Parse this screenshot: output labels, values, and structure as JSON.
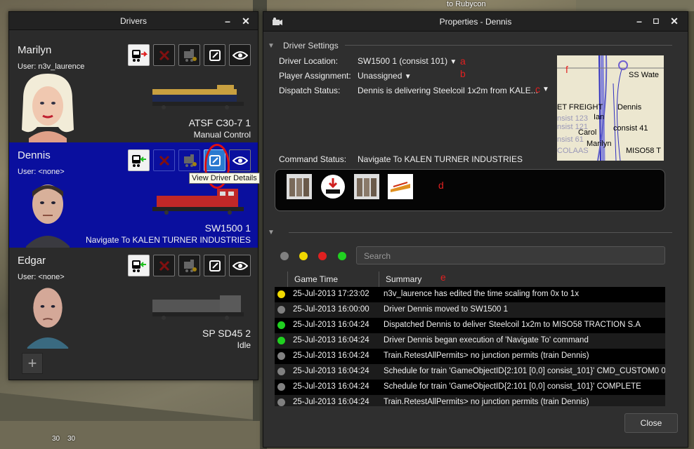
{
  "background": {
    "top_text": "to Rubycon",
    "sign_1": "30",
    "sign_2": "30"
  },
  "drivers_window": {
    "title": "Drivers",
    "minimize_label": "–",
    "close_label": "✕",
    "drivers": [
      {
        "name": "Marilyn",
        "user": "User: n3v_laurence",
        "loco_name": "ATSF C30-7 1",
        "status": "Manual Control",
        "loco_color": "#c8a040"
      },
      {
        "name": "Dennis",
        "user": "User: <none>",
        "loco_name": "SW1500 1",
        "status": "Navigate To KALEN TURNER INDUSTRIES",
        "loco_color": "#c02828"
      },
      {
        "name": "Edgar",
        "user": "User: <none>",
        "loco_name": "SP SD45 2",
        "status": "Idle",
        "loco_color": "#555555"
      }
    ],
    "tooltip": "View Driver Details",
    "add_label": "+"
  },
  "properties_window": {
    "title": "Properties - Dennis",
    "driver_settings_label": "Driver Settings",
    "driver_location_label": "Driver Location:",
    "driver_location_value": "SW1500 1 (consist 101)",
    "player_assignment_label": "Player Assignment:",
    "player_assignment_value": "Unassigned",
    "dispatch_status_label": "Dispatch Status:",
    "dispatch_status_value": "Dennis is delivering Steelcoil 1x2m from KALE...",
    "command_status_label": "Command Status:",
    "command_status_value": "Navigate To KALEN TURNER INDUSTRIES",
    "annotations": {
      "a": "a",
      "b": "b",
      "c": "c",
      "d": "d",
      "e": "e",
      "f": "f"
    },
    "map_labels": [
      "SS Wate",
      "ET FREIGHT",
      "Dennis",
      "nsist 123",
      "Ian",
      "nsist 121",
      "Carol",
      "consist 41",
      "nsist 61",
      "Marilyn",
      "COLAAS",
      "MISO58 T"
    ],
    "search_placeholder": "Search",
    "log_columns": {
      "time": "Game Time",
      "summary": "Summary"
    },
    "log_rows": [
      {
        "status": "yellow",
        "time": "25-Jul-2013 17:23:02",
        "summary": "n3v_laurence has edited the time scaling from 0x to 1x"
      },
      {
        "status": "gray",
        "time": "25-Jul-2013 16:00:00",
        "summary": "Driver Dennis moved to SW1500 1"
      },
      {
        "status": "green",
        "time": "25-Jul-2013 16:04:24",
        "summary": "Dispatched Dennis to deliver Steelcoil 1x2m to MISO58 TRACTION S.A"
      },
      {
        "status": "green",
        "time": "25-Jul-2013 16:04:24",
        "summary": "Driver Dennis began execution of 'Navigate To' command"
      },
      {
        "status": "gray",
        "time": "25-Jul-2013 16:04:24",
        "summary": "Train.RetestAllPermits> no junction permits (train Dennis)"
      },
      {
        "status": "gray",
        "time": "25-Jul-2013 16:04:24",
        "summary": "Schedule for train 'GameObjectID{2:101 [0,0] consist_101}' CMD_CUSTOM0 0"
      },
      {
        "status": "gray",
        "time": "25-Jul-2013 16:04:24",
        "summary": "Schedule for train 'GameObjectID{2:101 [0,0] consist_101}'  COMPLETE"
      },
      {
        "status": "gray",
        "time": "25-Jul-2013 16:04:24",
        "summary": "Train.RetestAllPermits> no junction permits (train Dennis)"
      }
    ],
    "close_button": "Close"
  },
  "colors": {
    "yellow": "#f0d800",
    "gray": "#808080",
    "green": "#20d020",
    "red": "#e02020",
    "selected_bg": "#0a0f9e"
  }
}
